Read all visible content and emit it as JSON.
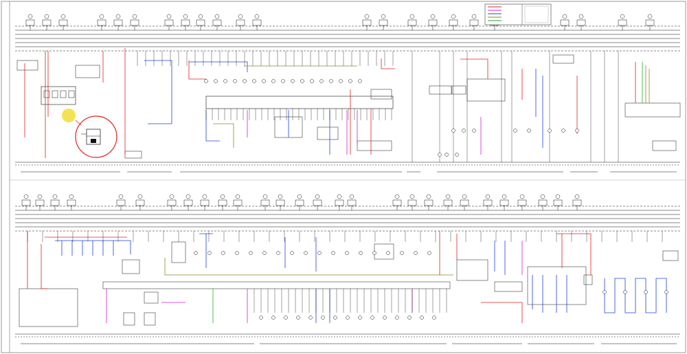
{
  "legend": {
    "entries": [
      {
        "label": "",
        "color": "#e02020"
      },
      {
        "label": "",
        "color": "#e020e0"
      },
      {
        "label": "",
        "color": "#2040e0"
      },
      {
        "label": "",
        "color": "#8a8a20"
      },
      {
        "label": "",
        "color": "#20a020"
      }
    ]
  },
  "wire_colors": {
    "red": "#e02020",
    "blue": "#2040e0",
    "magenta": "#d020d0",
    "olive": "#8a8a20",
    "green": "#20b020",
    "black": "#111111"
  },
  "highlight_color": "#f2e040",
  "circle_color": "#e02020"
}
